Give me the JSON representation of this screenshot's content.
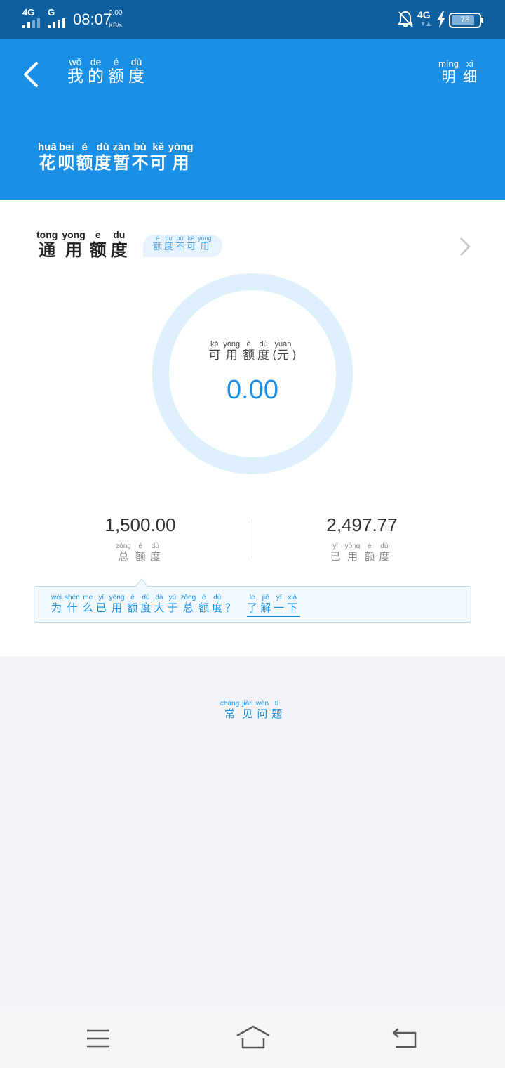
{
  "status_bar": {
    "network1": "4G",
    "network2": "G",
    "time": "08:07",
    "speed_value": "0.00",
    "speed_unit": "KB/s",
    "network3": "4G",
    "battery": "78"
  },
  "header": {
    "title": [
      {
        "char": "我",
        "py": "wǒ"
      },
      {
        "char": "的",
        "py": "de"
      },
      {
        "char": "额",
        "py": "é"
      },
      {
        "char": "度",
        "py": "dù"
      }
    ],
    "details": [
      {
        "char": "明",
        "py": "míng"
      },
      {
        "char": "细",
        "py": "xì"
      }
    ],
    "notice": [
      {
        "char": "花",
        "py": "huā"
      },
      {
        "char": "呗",
        "py": "bei"
      },
      {
        "char": "额",
        "py": "é"
      },
      {
        "char": "度",
        "py": "dù"
      },
      {
        "char": "暂",
        "py": "zàn"
      },
      {
        "char": "不",
        "py": "bù"
      },
      {
        "char": "可",
        "py": "kě"
      },
      {
        "char": "用",
        "py": "yòng"
      }
    ]
  },
  "card": {
    "title": [
      {
        "char": "通",
        "py": "tong"
      },
      {
        "char": "用",
        "py": "yong"
      },
      {
        "char": "额",
        "py": "e"
      },
      {
        "char": "度",
        "py": "du"
      }
    ],
    "tag": [
      {
        "char": "额",
        "py": "é"
      },
      {
        "char": "度",
        "py": "du"
      },
      {
        "char": "不",
        "py": "bù"
      },
      {
        "char": "可",
        "py": "kě"
      },
      {
        "char": "用",
        "py": "yòng"
      }
    ],
    "ring_label": [
      {
        "char": "可",
        "py": "kě"
      },
      {
        "char": "用",
        "py": "yòng"
      },
      {
        "char": "额",
        "py": "é"
      },
      {
        "char": "度",
        "py": "dù"
      }
    ],
    "ring_label_unit": {
      "char": "元",
      "py": "yuán"
    },
    "available_amount": "0.00",
    "available_fraction": 0,
    "total_amount": "1,500.00",
    "total_label": [
      {
        "char": "总",
        "py": "zǒng"
      },
      {
        "char": "额",
        "py": "é"
      },
      {
        "char": "度",
        "py": "dù"
      }
    ],
    "used_amount": "2,497.77",
    "used_label": [
      {
        "char": "已",
        "py": "yǐ"
      },
      {
        "char": "用",
        "py": "yòng"
      },
      {
        "char": "额",
        "py": "é"
      },
      {
        "char": "度",
        "py": "dù"
      }
    ],
    "tip": [
      {
        "char": "为",
        "py": "wèi"
      },
      {
        "char": "什",
        "py": "shén"
      },
      {
        "char": "么",
        "py": "me"
      },
      {
        "char": "已",
        "py": "yǐ"
      },
      {
        "char": "用",
        "py": "yòng"
      },
      {
        "char": "额",
        "py": "é"
      },
      {
        "char": "度",
        "py": "dù"
      },
      {
        "char": "大",
        "py": "dà"
      },
      {
        "char": "于",
        "py": "yú"
      },
      {
        "char": "总",
        "py": "zǒng"
      },
      {
        "char": "额",
        "py": "é"
      },
      {
        "char": "度",
        "py": "dù"
      },
      {
        "char": "？",
        "py": ""
      }
    ],
    "tip_link": [
      {
        "char": "了",
        "py": "le"
      },
      {
        "char": "解",
        "py": "jiě"
      },
      {
        "char": "一",
        "py": "yī"
      },
      {
        "char": "下",
        "py": "xià"
      }
    ]
  },
  "faq": [
    {
      "char": "常",
      "py": "cháng"
    },
    {
      "char": "见",
      "py": "jiàn"
    },
    {
      "char": "问",
      "py": "wèn"
    },
    {
      "char": "题",
      "py": "tí"
    }
  ],
  "colors": {
    "brand_blue": "#1a8fe6",
    "status_bar": "#0d5fa0",
    "ring": "#dff0fd"
  },
  "nav": {
    "menu_icon": "menu-icon",
    "home_icon": "home-icon",
    "back_icon": "back-icon"
  }
}
